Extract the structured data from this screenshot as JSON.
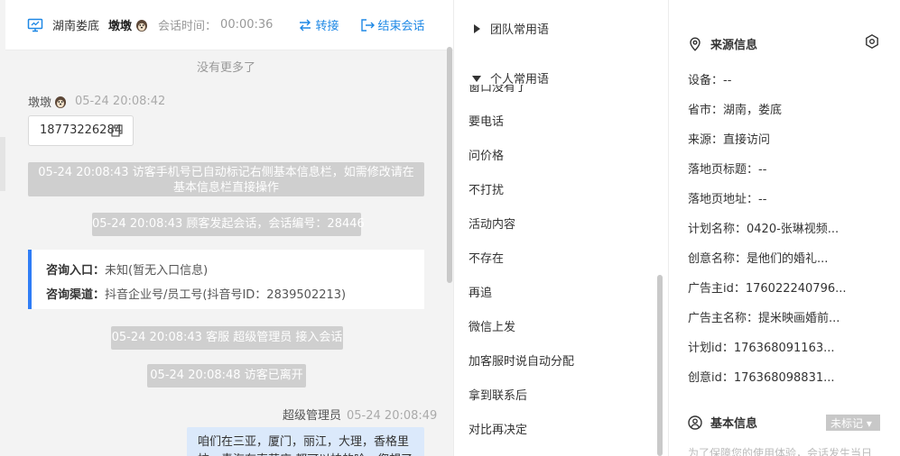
{
  "header": {
    "location": "湖南娄底",
    "visitor_name": "墩墩",
    "session_time_label": "会话时间：",
    "session_time": "00:00:36",
    "transfer_label": "转接",
    "end_label": "结束会话",
    "accent_color": "#1e88e5"
  },
  "chat": {
    "no_more": "没有更多了",
    "visitor": {
      "name": "墩墩",
      "time": "05-24 20:08:42",
      "phone": "18773226284"
    },
    "system_messages": [
      "05-24 20:08:43 访客手机号已自动标记右侧基本信息栏，如需修改请在基本信息栏直接操作",
      "05-24 20:08:43 顾客发起会话，会话编号：28446",
      "05-24 20:08:43 客服 超级管理员 接入会话",
      "05-24 20:08:48 访客已离开"
    ],
    "consult": {
      "entry_label": "咨询入口：",
      "entry_value": "未知(暂无入口信息)",
      "channel_label": "咨询渠道：",
      "channel_value": "抖音企业号/员工号(抖音号ID：2839502213)"
    },
    "agent": {
      "name": "超级管理员",
      "time": "05-24 20:08:49",
      "message": "咱们在三亚，厦门，丽江，大理，香格里拉，青海有直营店 都可以拍的哈，您想了解哪里呢？"
    }
  },
  "phrases": {
    "team_label": "团队常用语",
    "personal_label": "个人常用语",
    "partial_item": "窗口没有了",
    "items": [
      "要电话",
      "问价格",
      "不打扰",
      "活动内容",
      "不存在",
      "再追",
      "微信上发",
      "加客服时说自动分配",
      "拿到联系后",
      "对比再决定"
    ]
  },
  "info": {
    "source_title": "来源信息",
    "rows": [
      "设备：--",
      "省市：湖南，娄底",
      "来源：直接访问",
      "落地页标题：--",
      "落地页地址：--",
      "计划名称：0420-张琳视频...",
      "创意名称：是他们的婚礼...",
      "广告主id：176022240796...",
      "广告主名称：提米映画婚前...",
      "计划id：176368091163...",
      "创意id：176368098831..."
    ],
    "basic_title": "基本信息",
    "tag_label": "未标记",
    "note": "为了保障您的使用体验，会话发生当日"
  }
}
